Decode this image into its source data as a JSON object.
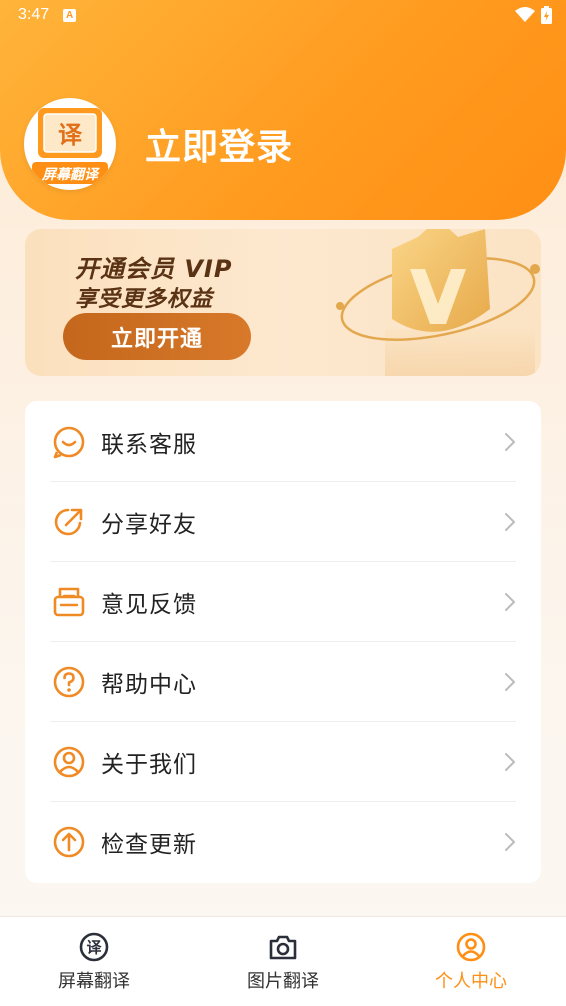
{
  "status_bar": {
    "time": "3:47",
    "notification_icon": "A",
    "icons": [
      "wifi-icon",
      "battery-icon"
    ]
  },
  "header": {
    "login_title": "立即登录",
    "avatar": {
      "logo_char": "译",
      "logo_text": "屏幕翻译"
    }
  },
  "vip_banner": {
    "line1": "开通会员 VIP",
    "line2": "享受更多权益",
    "button_label": "立即开通"
  },
  "menu": {
    "items": [
      {
        "label": "联系客服",
        "icon": "headset-chat-icon"
      },
      {
        "label": "分享好友",
        "icon": "share-arrow-icon"
      },
      {
        "label": "意见反馈",
        "icon": "feedback-mail-icon"
      },
      {
        "label": "帮助中心",
        "icon": "help-question-icon"
      },
      {
        "label": "关于我们",
        "icon": "user-profile-icon"
      },
      {
        "label": "检查更新",
        "icon": "upload-arrow-icon"
      }
    ]
  },
  "bottom_nav": {
    "items": [
      {
        "label": "屏幕翻译",
        "icon": "translate-icon",
        "active": false
      },
      {
        "label": "图片翻译",
        "icon": "camera-icon",
        "active": false
      },
      {
        "label": "个人中心",
        "icon": "person-icon",
        "active": true
      }
    ]
  },
  "colors": {
    "accent": "#ff9a1e",
    "vip_text": "#5a3214",
    "vip_button": "#c4671c",
    "icon_orange": "#f08a24"
  }
}
